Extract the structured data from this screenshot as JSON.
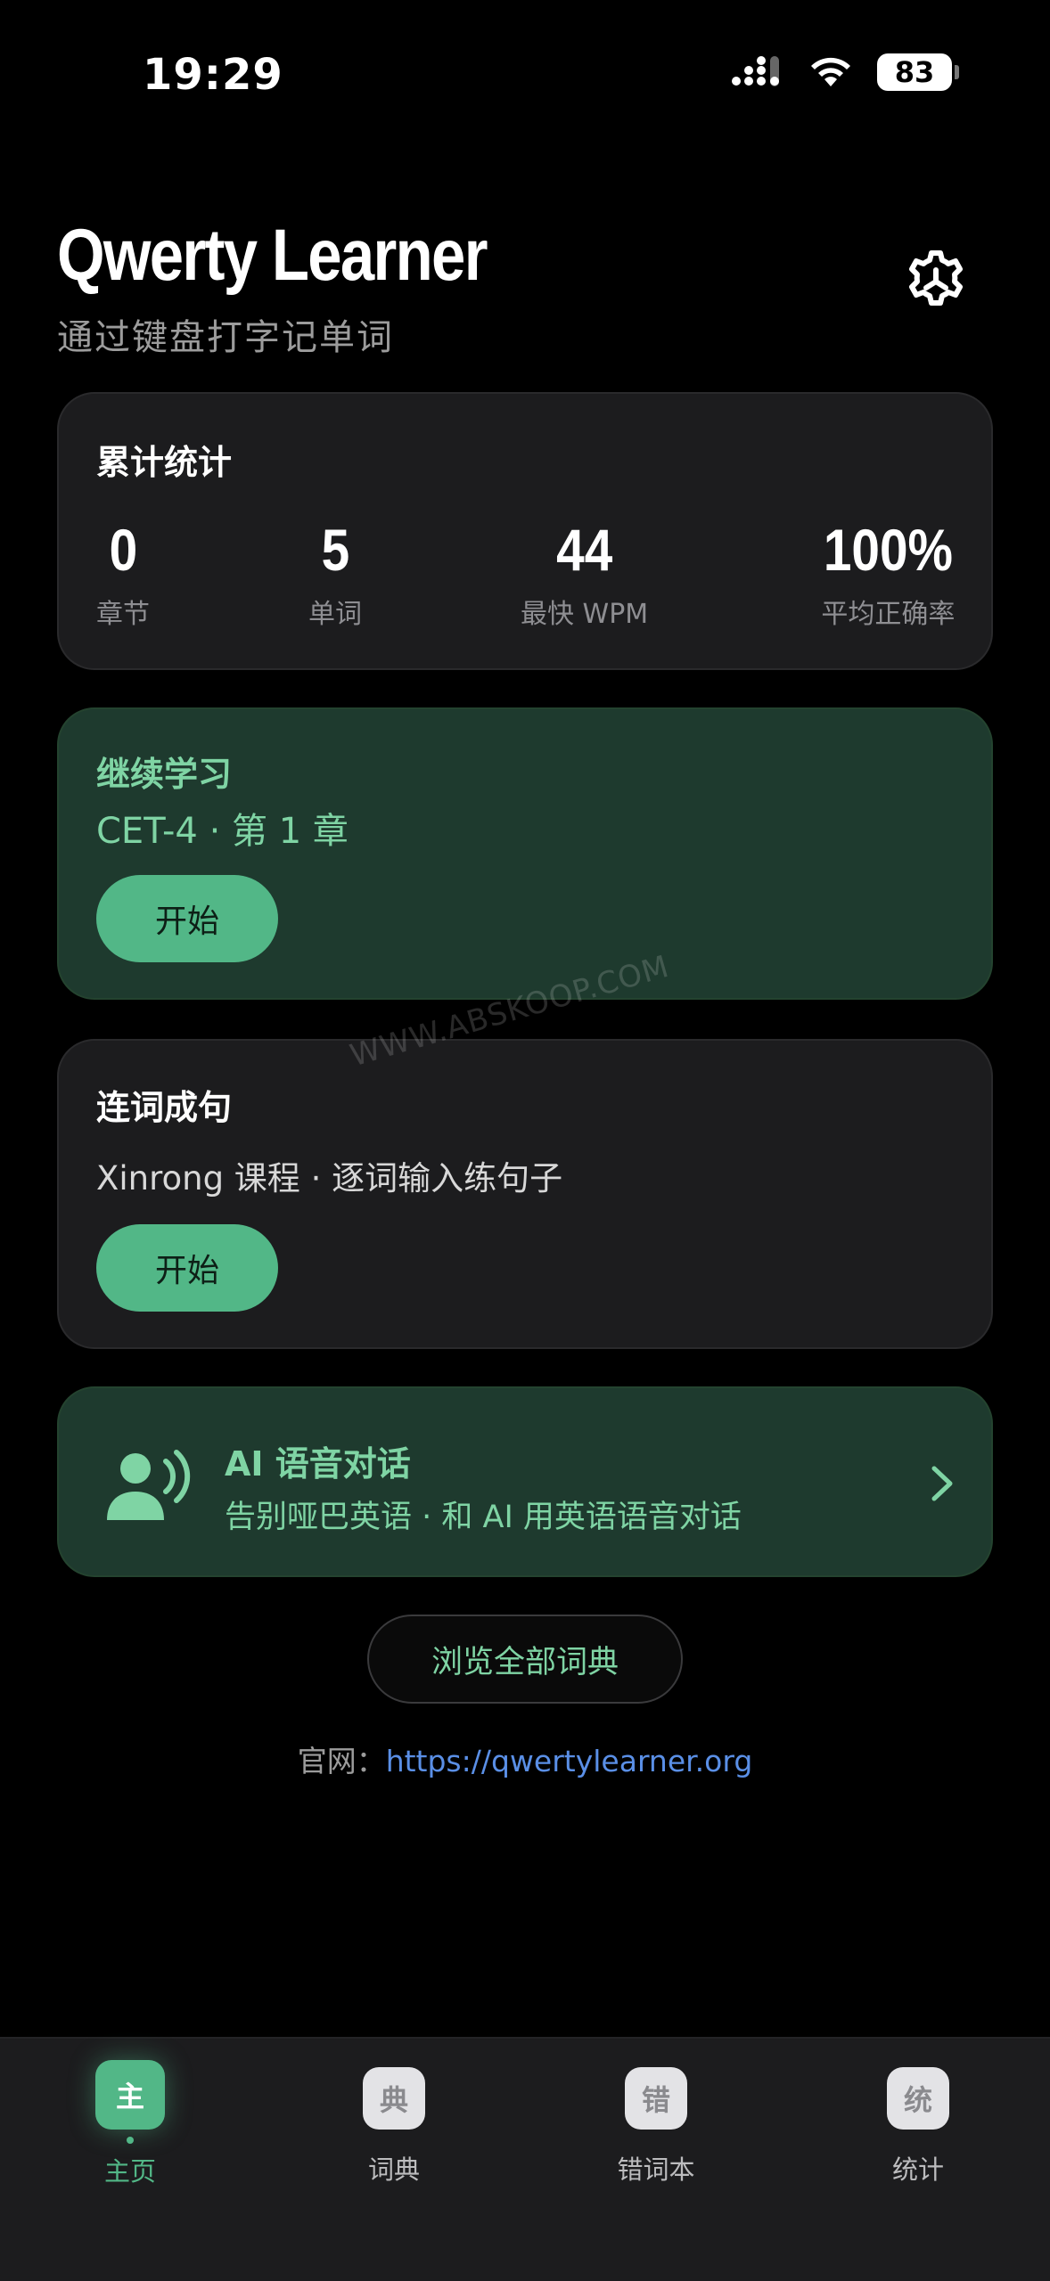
{
  "status_bar": {
    "time": "19:29",
    "battery": "83"
  },
  "header": {
    "title": "Qwerty Learner",
    "subtitle": "通过键盘打字记单词",
    "settings_icon": "gear-icon"
  },
  "stats": {
    "title": "累计统计",
    "items": [
      {
        "value": "0",
        "label": "章节"
      },
      {
        "value": "5",
        "label": "单词"
      },
      {
        "value": "44",
        "label": "最快 WPM"
      },
      {
        "value": "100%",
        "label": "平均正确率"
      }
    ]
  },
  "continue_learning": {
    "title": "继续学习",
    "subtitle": "CET-4 · 第 1 章",
    "button": "开始"
  },
  "sentence_practice": {
    "title": "连词成句",
    "subtitle": "Xinrong 课程 · 逐词输入练句子",
    "button": "开始"
  },
  "ai_voice": {
    "title": "AI 语音对话",
    "subtitle": "告别哑巴英语 · 和 AI 用英语语音对话",
    "icon": "voice-person-icon"
  },
  "browse_button": "浏览全部词典",
  "website": {
    "label": "官网：",
    "url": "https://qwertylearner.org"
  },
  "watermark": "WWW.ABSKOOP.COM",
  "tabs": [
    {
      "icon": "主",
      "label": "主页",
      "active": true
    },
    {
      "icon": "典",
      "label": "词典",
      "active": false
    },
    {
      "icon": "错",
      "label": "错词本",
      "active": false
    },
    {
      "icon": "统",
      "label": "统计",
      "active": false
    }
  ],
  "colors": {
    "accent": "#52b787",
    "accent_text": "#7fd4a4",
    "card_green": "#1e3a2e",
    "card_dark": "#1c1c1e",
    "link": "#5a8fe6"
  }
}
